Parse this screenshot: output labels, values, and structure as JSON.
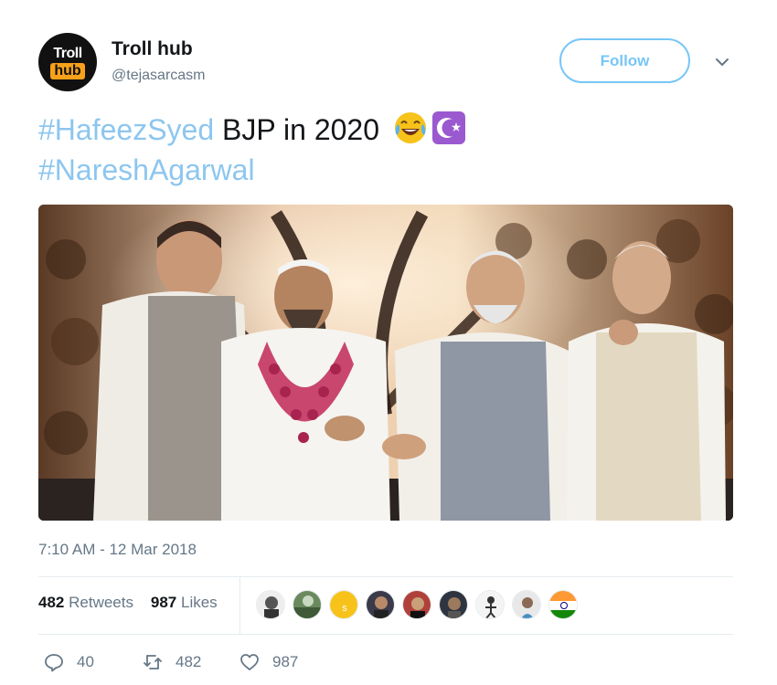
{
  "user": {
    "avatar_line1": "Troll",
    "avatar_line2": "hub",
    "display_name": "Troll hub",
    "handle": "@tejasarcasm"
  },
  "follow_label": "Follow",
  "tweet": {
    "hashtag1": "#HafeezSyed",
    "text1": " BJP in 2020",
    "hashtag2": "#NareshAgarwal"
  },
  "timestamp": "7:10 AM - 12 Mar 2018",
  "stats": {
    "retweets_count": "482",
    "retweets_label": "Retweets",
    "likes_count": "987",
    "likes_label": "Likes"
  },
  "actions": {
    "reply_count": "40",
    "retweet_count": "482",
    "like_count": "987"
  },
  "likers": [
    {
      "icon": "portrait-icon",
      "color": "#d9d9d9"
    },
    {
      "icon": "landscape-icon",
      "color": "#4f6b4a"
    },
    {
      "icon": "yellow-coin-icon",
      "color": "#f7c21a"
    },
    {
      "icon": "portrait-icon",
      "color": "#3a3a4a"
    },
    {
      "icon": "portrait-icon",
      "color": "#b0413a"
    },
    {
      "icon": "portrait-icon",
      "color": "#2f3540"
    },
    {
      "icon": "figure-icon",
      "color": "#f2f2f2"
    },
    {
      "icon": "portrait-icon",
      "color": "#e8e8e8"
    },
    {
      "icon": "india-flag-icon",
      "color": "#ff9933"
    }
  ],
  "colors": {
    "accent": "#1da1f2",
    "hashtag": "#8dc6ef",
    "muted": "#657786"
  }
}
